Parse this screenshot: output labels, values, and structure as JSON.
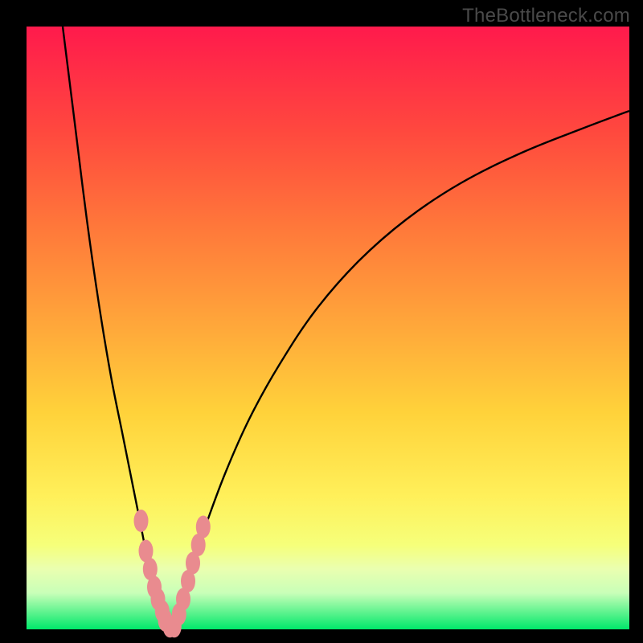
{
  "watermark": "TheBottleneck.com",
  "colors": {
    "frame": "#000000",
    "grad_top": "#ff1a4c",
    "grad_mid1": "#ff7a3a",
    "grad_mid2": "#ffd23a",
    "grad_low": "#f6ff7a",
    "grad_band": "#eaffb0",
    "grad_bottom": "#00e86a",
    "curve": "#000000",
    "marker_fill": "#e98b8f",
    "marker_stroke": "#c76a6e"
  },
  "gradient_css": "linear-gradient(to bottom, #ff1a4c 0%, #ff4a3e 18%, #ff7a3a 34%, #ffae3a 52%, #ffd23a 64%, #fff05a 78%, #f6ff7a 86%, #eaffb0 90%, #c8ffb8 94%, #00e86a 100%)",
  "chart_data": {
    "type": "line",
    "title": "",
    "xlabel": "",
    "ylabel": "",
    "xlim": [
      0,
      100
    ],
    "ylim": [
      0,
      100
    ],
    "annotations": [
      "TheBottleneck.com"
    ],
    "series": [
      {
        "name": "left-curve",
        "x": [
          6,
          8,
          10,
          12,
          14,
          16,
          18,
          19,
          20,
          21,
          22,
          23,
          24
        ],
        "y": [
          100,
          84,
          68,
          54,
          42,
          32,
          22,
          17,
          12,
          8,
          5,
          2,
          0
        ]
      },
      {
        "name": "right-curve",
        "x": [
          24,
          25,
          26,
          27,
          28,
          30,
          33,
          37,
          42,
          48,
          55,
          63,
          72,
          82,
          92,
          100
        ],
        "y": [
          0,
          3,
          6,
          9,
          12,
          18,
          26,
          35,
          44,
          53,
          61,
          68,
          74,
          79,
          83,
          86
        ]
      }
    ],
    "markers_left": [
      {
        "x": 19.0,
        "y": 18
      },
      {
        "x": 19.8,
        "y": 13
      },
      {
        "x": 20.5,
        "y": 10
      },
      {
        "x": 21.2,
        "y": 7
      },
      {
        "x": 21.8,
        "y": 5
      },
      {
        "x": 22.5,
        "y": 3
      },
      {
        "x": 23.0,
        "y": 1.5
      },
      {
        "x": 23.8,
        "y": 0.5
      }
    ],
    "markers_right": [
      {
        "x": 24.5,
        "y": 0.5
      },
      {
        "x": 25.3,
        "y": 2.5
      },
      {
        "x": 26.0,
        "y": 5
      },
      {
        "x": 26.8,
        "y": 8
      },
      {
        "x": 27.6,
        "y": 11
      },
      {
        "x": 28.5,
        "y": 14
      },
      {
        "x": 29.3,
        "y": 17
      }
    ]
  }
}
